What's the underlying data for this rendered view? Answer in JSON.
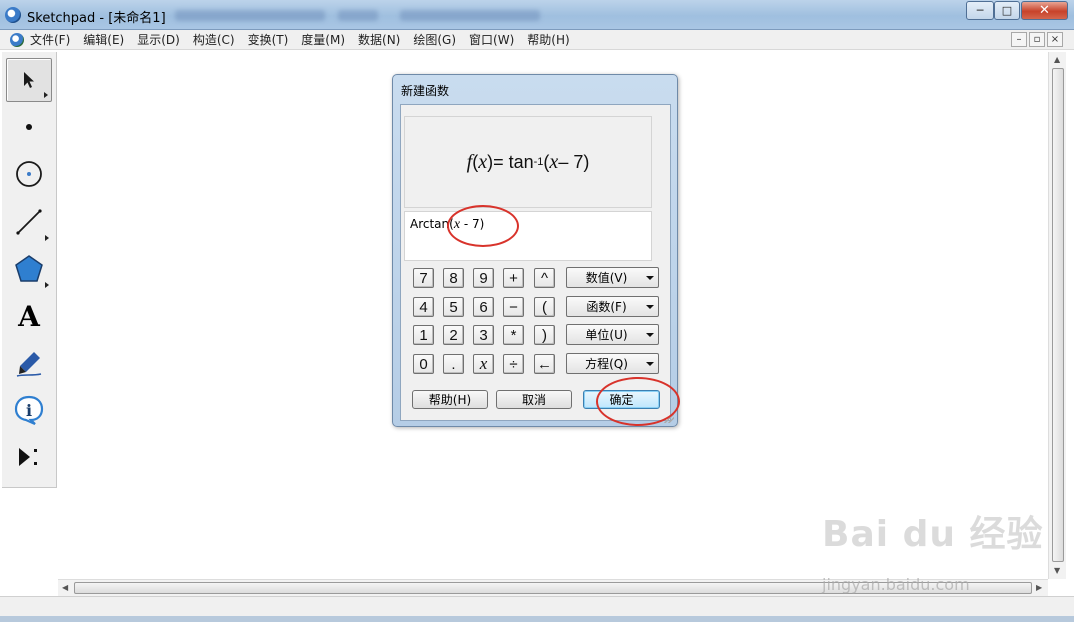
{
  "window": {
    "title": "Sketchpad  - [未命名1]",
    "minimize": "─",
    "maximize": "□",
    "close": "✕"
  },
  "menubar": {
    "items": [
      "文件(F)",
      "编辑(E)",
      "显示(D)",
      "构造(C)",
      "变换(T)",
      "度量(M)",
      "数据(N)",
      "绘图(G)",
      "窗口(W)",
      "帮助(H)"
    ],
    "doc_minimize": "–",
    "doc_restore": "▫",
    "doc_close": "×"
  },
  "toolbox": {
    "tools": [
      "arrow-select-tool",
      "point-tool",
      "compass-tool",
      "straightedge-tool",
      "polygon-tool",
      "text-tool",
      "marker-tool",
      "information-tool",
      "custom-tool"
    ],
    "text_tool_glyph": "A"
  },
  "dialog": {
    "title": "新建函数",
    "formula": {
      "fname": "f",
      "var": "x",
      "eq": " = tan",
      "sup": "-1",
      "rest_open": "(",
      "rest_var": "x",
      "rest_tail": " – 7)"
    },
    "expression": {
      "prefix": "Arctan(",
      "var": "x",
      "tail": " - 7)"
    },
    "keypad": [
      [
        "7",
        "8",
        "9",
        "+",
        "^"
      ],
      [
        "4",
        "5",
        "6",
        "−",
        "("
      ],
      [
        "1",
        "2",
        "3",
        "*",
        ")"
      ],
      [
        "0",
        ".",
        "x",
        "÷",
        "←"
      ]
    ],
    "dropdowns": [
      "数值(V)",
      "函数(F)",
      "单位(U)",
      "方程(Q)"
    ],
    "buttons": {
      "help": "帮助(H)",
      "cancel": "取消",
      "ok": "确定"
    }
  },
  "watermark": {
    "text": "Bai du 经验",
    "url": "jingyan.baidu.com"
  },
  "colors": {
    "annotation_red": "#d8332b",
    "titlebar_blue": "#9fbfdf"
  }
}
